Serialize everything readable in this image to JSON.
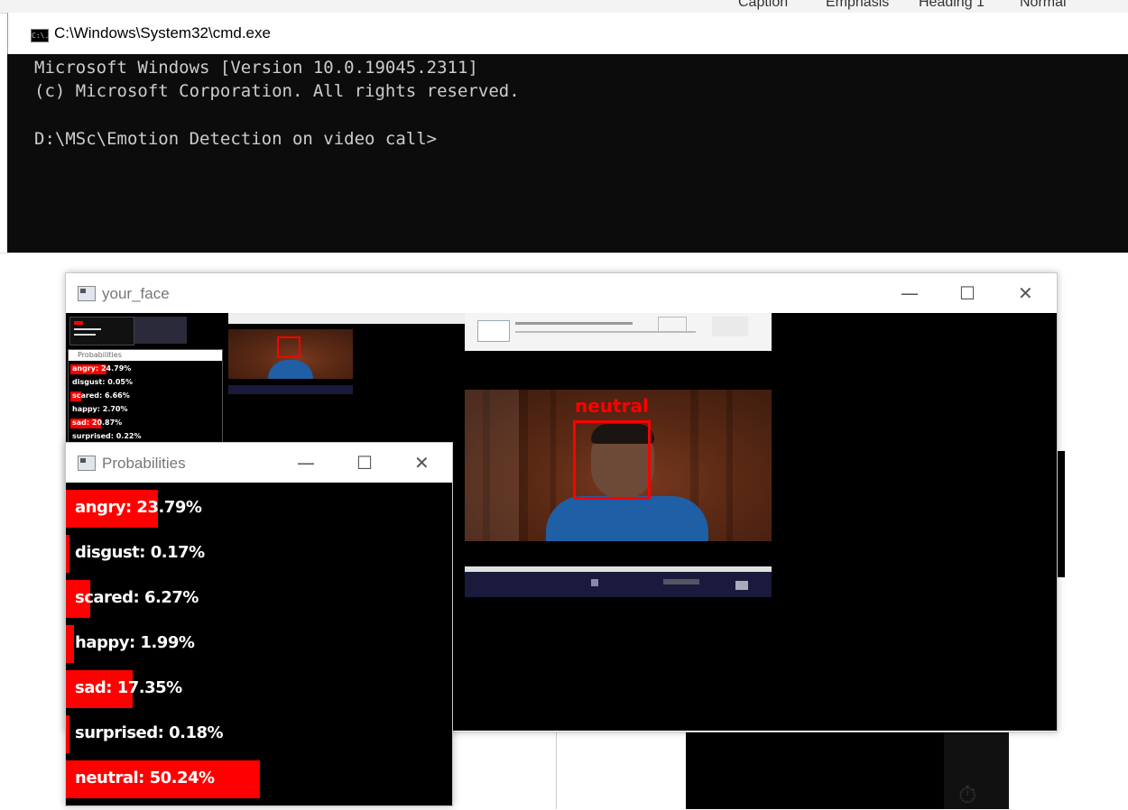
{
  "ribbon_peek": [
    "Caption",
    "Emphasis",
    "Heading 1",
    "Normal"
  ],
  "cmd": {
    "title": "C:\\Windows\\System32\\cmd.exe",
    "icon_text": "C:\\.",
    "lines": [
      "Microsoft Windows [Version 10.0.19045.2311]",
      "(c) Microsoft Corporation. All rights reserved.",
      "",
      "D:\\MSc\\Emotion Detection on video call>"
    ]
  },
  "face_window": {
    "title": "your_face",
    "controls": {
      "minimize": "—",
      "maximize": "☐",
      "close": "✕"
    },
    "detected_emotion": "neutral",
    "mini_probabilities": [
      "angry: 24.79%",
      "disgust: 0.05%",
      "scared: 6.66%",
      "happy: 2.70%",
      "sad: 20.87%",
      "surprised: 0.22%"
    ],
    "mini_prob_title": "Probabilities"
  },
  "prob_window": {
    "title": "Probabilities",
    "controls": {
      "minimize": "—",
      "maximize": "☐",
      "close": "✕"
    },
    "rows": [
      {
        "label": "angry: 23.79%",
        "value": 23.79
      },
      {
        "label": "disgust: 0.17%",
        "value": 0.17
      },
      {
        "label": "scared: 6.27%",
        "value": 6.27
      },
      {
        "label": "happy: 1.99%",
        "value": 1.99
      },
      {
        "label": "sad: 17.35%",
        "value": 17.35
      },
      {
        "label": "surprised: 0.18%",
        "value": 0.18
      },
      {
        "label": "neutral: 50.24%",
        "value": 50.24
      }
    ]
  },
  "colors": {
    "bar": "#ff0000",
    "console_bg": "#0c0c0c",
    "console_text": "#cccccc"
  },
  "icons": [
    "cmd-icon",
    "window-icon",
    "timer-icon"
  ]
}
